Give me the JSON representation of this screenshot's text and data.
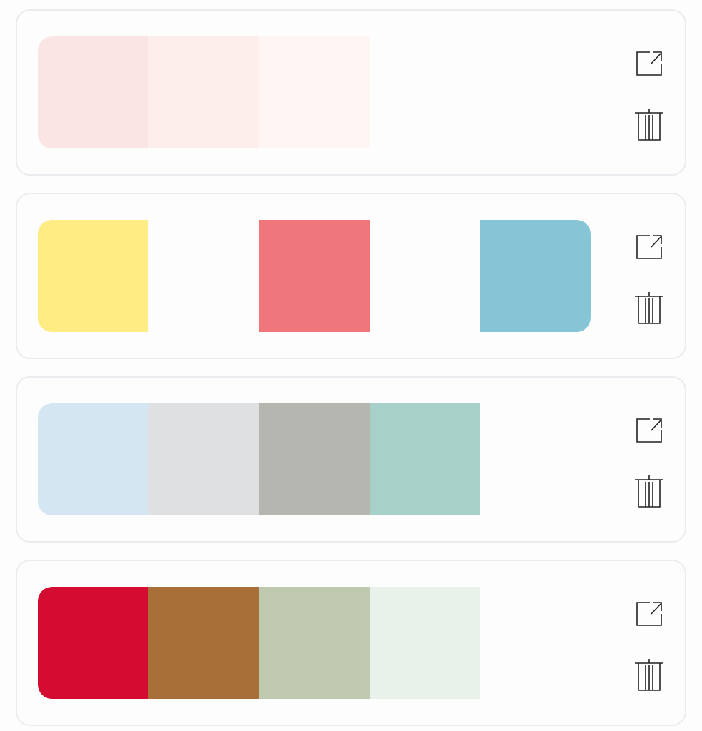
{
  "palettes": [
    {
      "swatches": [
        {
          "color": "#fae5e4"
        },
        {
          "color": "#fdeeec"
        },
        {
          "color": "#fff6f3"
        }
      ]
    },
    {
      "swatches": [
        {
          "kind": "color",
          "color": "#ffec82"
        },
        {
          "kind": "empty"
        },
        {
          "kind": "color",
          "color": "#ef777c"
        },
        {
          "kind": "empty"
        },
        {
          "kind": "color",
          "color": "#86c5d6"
        }
      ]
    },
    {
      "swatches": [
        {
          "color": "#d4e6f1"
        },
        {
          "color": "#dfe0e2"
        },
        {
          "color": "#b5b6b0"
        },
        {
          "color": "#a7d0c8"
        }
      ]
    },
    {
      "swatches": [
        {
          "color": "#d50c31"
        },
        {
          "color": "#a96f38"
        },
        {
          "color": "#bfc9af"
        },
        {
          "color": "#e9f1eb"
        }
      ]
    }
  ]
}
